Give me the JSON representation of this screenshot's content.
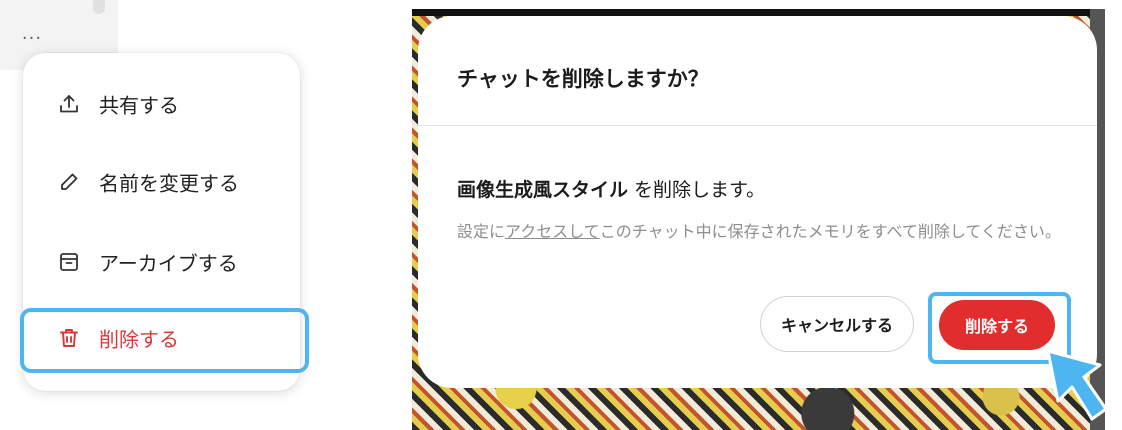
{
  "left_panel": {
    "more_label": "...",
    "menu": {
      "items": [
        {
          "label": "共有する",
          "icon": "share-icon"
        },
        {
          "label": "名前を変更する",
          "icon": "pencil-icon"
        },
        {
          "label": "アーカイブする",
          "icon": "archive-icon"
        },
        {
          "label": "削除する",
          "icon": "trash-icon"
        }
      ]
    }
  },
  "dialog": {
    "title": "チャットを削除しますか？",
    "message_strong": "画像生成風スタイル",
    "message_rest": " を削除します。",
    "note_pre": "設定に",
    "note_link": "アクセスして",
    "note_post": "このチャット中に保存されたメモリをすべて削除してください。",
    "cancel_label": "キャンセルする",
    "delete_label": "削除する"
  },
  "colors": {
    "accent_highlight": "#4db5ef",
    "danger": "#d93838",
    "delete_button": "#e12d2d"
  }
}
